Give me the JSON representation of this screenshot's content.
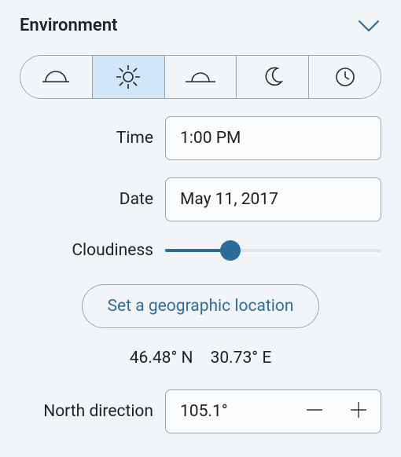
{
  "section_title": "Environment",
  "tod_icons": [
    "sunrise",
    "sun",
    "sunset",
    "moon",
    "clock"
  ],
  "selected_tod_index": 1,
  "labels": {
    "time": "Time",
    "date": "Date",
    "cloudiness": "Cloudiness",
    "north": "North direction"
  },
  "time_value": "1:00 PM",
  "date_value": "May 11, 2017",
  "cloudiness_fraction": 0.3,
  "location_button": "Set a geographic location",
  "latitude": "46.48° N",
  "longitude": "30.73° E",
  "north_direction": "105.1°"
}
